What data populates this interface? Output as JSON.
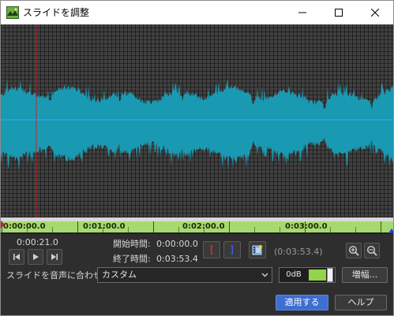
{
  "window": {
    "title": "スライドを調整",
    "controls": [
      "minimize",
      "maximize",
      "close"
    ]
  },
  "timeline": {
    "ticks": [
      "0:00:00.0",
      "0:01:00.0",
      "0:02:00.0",
      "0:03:00.0"
    ],
    "playhead_seconds": 21.0,
    "duration_seconds": 233.4
  },
  "transport": {
    "current_time": "0:00:21.0",
    "buttons": [
      "skip-back",
      "play",
      "skip-forward"
    ]
  },
  "range": {
    "start_label": "開始時間:",
    "start_value": "0:00:00.0",
    "end_label": "終了時間:",
    "end_value": "0:03:53.4",
    "duration": "(0:03:53.4)",
    "set_start": "[",
    "set_end": "]"
  },
  "fit": {
    "label": "スライドを音声に合わせる:",
    "value": "カスタム"
  },
  "volume": {
    "label": "0dB",
    "level": 0.75
  },
  "buttons": {
    "amplify": "増幅...",
    "apply": "適用する",
    "help": "ヘルプ"
  },
  "colors": {
    "waveform": "#1a9ab2",
    "center_line": "#2aa6e0",
    "playhead": "#c0262d",
    "timeline": "#a6d96f",
    "apply": "#3d6ed0"
  }
}
